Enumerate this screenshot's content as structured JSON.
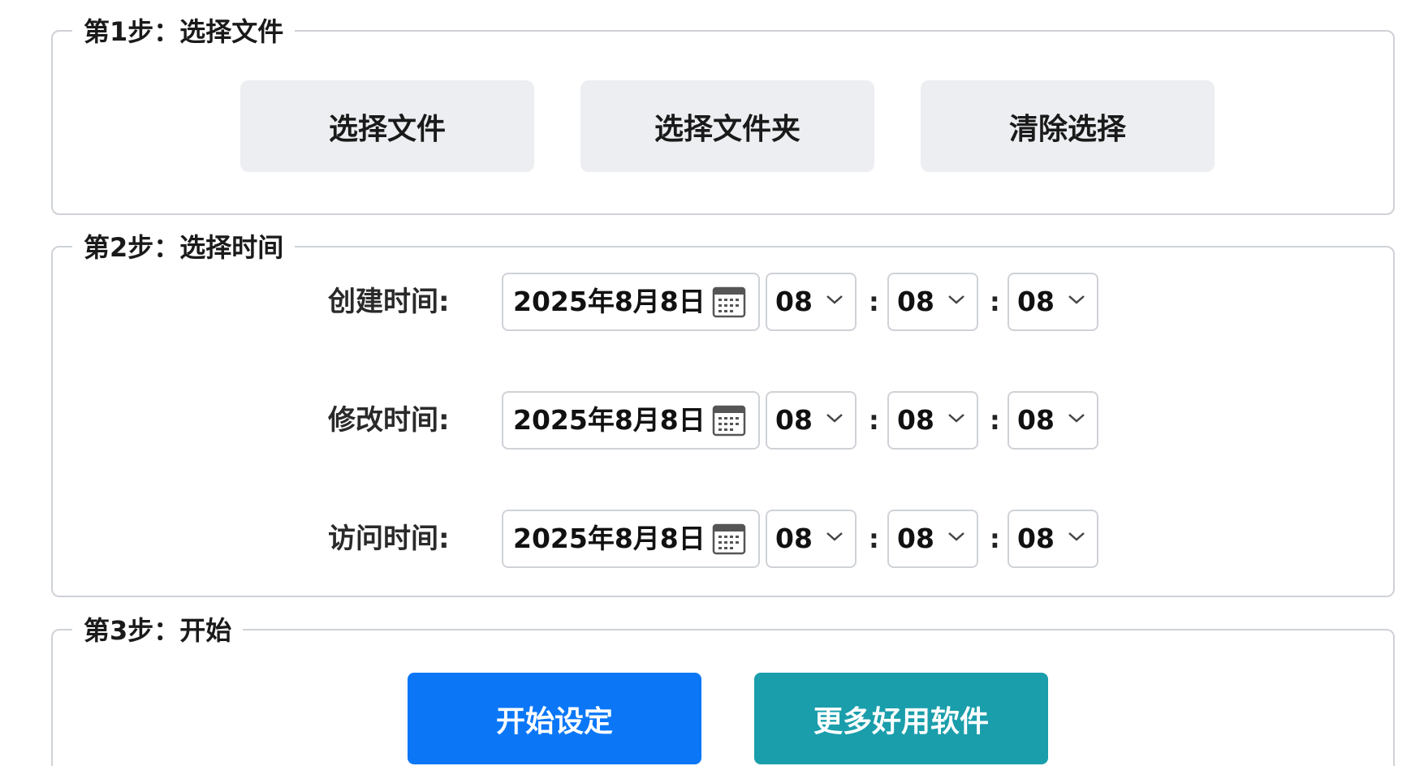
{
  "step1": {
    "legend": "第1步：选择文件",
    "buttons": {
      "select_file": "选择文件",
      "select_folder": "选择文件夹",
      "clear_selection": "清除选择"
    }
  },
  "step2": {
    "legend": "第2步：选择时间",
    "rows": [
      {
        "label": "创建时间:",
        "date": "2025年8月8日",
        "hour": "08",
        "minute": "08",
        "second": "08"
      },
      {
        "label": "修改时间:",
        "date": "2025年8月8日",
        "hour": "08",
        "minute": "08",
        "second": "08"
      },
      {
        "label": "访问时间:",
        "date": "2025年8月8日",
        "hour": "08",
        "minute": "08",
        "second": "08"
      }
    ],
    "separator": ":"
  },
  "step3": {
    "legend": "第3步：开始",
    "buttons": {
      "start": "开始设定",
      "more": "更多好用软件"
    }
  },
  "colors": {
    "start_button": "#0b77f7",
    "more_button": "#1a9eab",
    "gray_button": "#eceef1",
    "border": "#cfd2d6"
  },
  "icons": {
    "calendar": "calendar-icon",
    "dropdown": "chevron-down-icon"
  }
}
